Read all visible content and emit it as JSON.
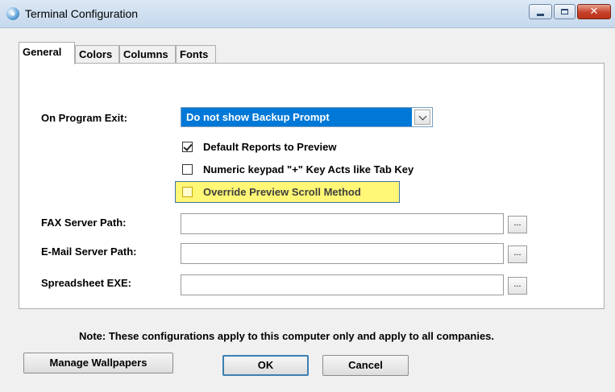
{
  "window": {
    "title": "Terminal Configuration",
    "app_icon": "terminal-app-icon"
  },
  "titlebar_buttons": {
    "minimize": "minimize-icon",
    "maximize": "maximize-icon",
    "close": "close-icon",
    "close_glyph": "✕"
  },
  "tabs": [
    {
      "label": "General",
      "active": true
    },
    {
      "label": "Colors",
      "active": false
    },
    {
      "label": "Columns",
      "active": false
    },
    {
      "label": "Fonts",
      "active": false
    }
  ],
  "general": {
    "on_exit_label": "On Program Exit:",
    "on_exit_value": "Do not show Backup Prompt",
    "checkboxes": [
      {
        "label": "Default Reports to Preview",
        "checked": true
      },
      {
        "label": "Numeric keypad \"+\" Key Acts like Tab Key",
        "checked": false
      },
      {
        "label": "Override Preview Scroll Method",
        "checked": false,
        "highlighted": true
      }
    ],
    "fax_label": "FAX Server Path:",
    "fax_value": "",
    "email_label": "E-Mail Server Path:",
    "email_value": "",
    "spreadsheet_label": "Spreadsheet EXE:",
    "spreadsheet_value": "",
    "browse_label": "..."
  },
  "note": "Note:  These configurations apply to this computer only and apply to all companies.",
  "buttons": {
    "manage_wallpapers": "Manage Wallpapers",
    "ok": "OK",
    "cancel": "Cancel"
  },
  "colors": {
    "selection": "#0078d7",
    "highlight": "#fff775",
    "highlight_border": "#3d72a8",
    "close_button": "#c7422a"
  }
}
